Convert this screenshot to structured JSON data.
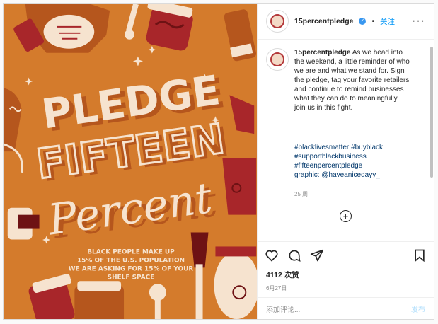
{
  "account": {
    "username": "15percentpledge",
    "verified_mark": "✓",
    "follow_label": "关注",
    "more_label": "···"
  },
  "artwork": {
    "title_line1": "PLEDGE",
    "title_line2": "FIFTEEN",
    "title_line3": "Percent",
    "subtext_line1": "BLACK PEOPLE MAKE UP",
    "subtext_line2": "15% OF THE U.S. POPULATION",
    "subtext_line3": "WE ARE ASKING FOR 15% OF YOUR",
    "subtext_line4": "SHELF SPACE",
    "colors": {
      "background": "#d47b2c",
      "shadow": "#b5561d",
      "cream": "#f6e3cf",
      "red": "#a8262a"
    }
  },
  "caption": {
    "username": "15percentpledge",
    "lines": [
      "As we head into",
      "the weekend, a little reminder of who",
      "we are and what we stand for. Sign",
      "the pledge, tag your favorite retailers",
      "and continue to remind businesses",
      "what they can do to meaningfully",
      "join us in this fight."
    ],
    "tags": [
      "#blacklivesmatter #buyblack",
      "#supportblackbusiness",
      "#fifteenpercentpledge",
      "graphic: @haveanicedayy_"
    ],
    "time": "25 周"
  },
  "load_more_label": "+",
  "icons": {
    "like": "heart-icon",
    "comment": "comment-icon",
    "share": "send-icon",
    "save": "bookmark-icon"
  },
  "likes": "4112 次赞",
  "date": "6月27日",
  "comment_input": {
    "placeholder": "添加评论...",
    "post_label": "发布"
  }
}
